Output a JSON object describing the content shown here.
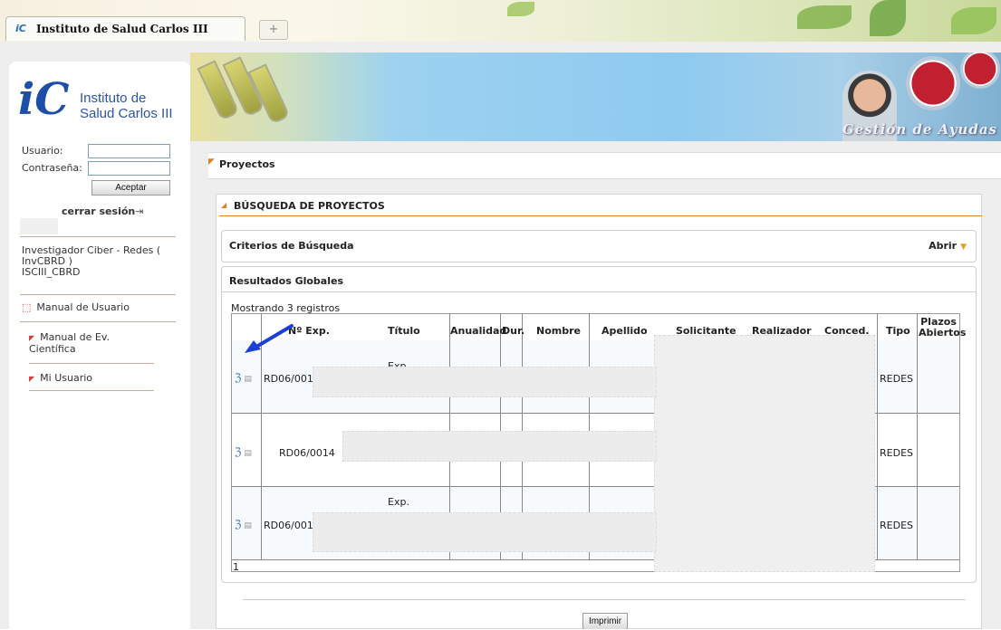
{
  "browser": {
    "tab_title": "Instituto de Salud Carlos III",
    "tab_icon": "isciii-favicon",
    "new_tab_label": "+"
  },
  "logo": {
    "mark": "iC",
    "line1": "Instituto de",
    "line2": "Salud Carlos III"
  },
  "login": {
    "user_label": "Usuario:",
    "user_value": "",
    "password_label": "Contraseña:",
    "password_value": "",
    "accept_label": "Aceptar",
    "logout_label": "cerrar sesión"
  },
  "user_info": {
    "line1": "Investigador Ciber - Redes (",
    "line2": "InvCBRD )",
    "line3": "ISCIII_CBRD"
  },
  "sidebar": {
    "items": [
      {
        "label": "Manual de Usuario"
      },
      {
        "label": "Manual de Ev. Científica"
      },
      {
        "label": "Mi Usuario"
      }
    ]
  },
  "banner": {
    "title": "Gestión de Ayudas"
  },
  "breadcrumb": {
    "label": "Proyectos"
  },
  "main": {
    "title": "BÚSQUEDA DE PROYECTOS",
    "criteria_label": "Criterios de Búsqueda",
    "open_label": "Abrir",
    "results_label": "Resultados Globales",
    "showing": "Mostrando 3 registros",
    "columns": [
      "Nº Exp.",
      "Título",
      "Anualidad",
      "Dur.",
      "Nombre",
      "Apellido",
      "Solicitante",
      "Realizador",
      "Conced.",
      "Tipo",
      "Plazos Abiertos"
    ],
    "rows": [
      {
        "exp": "RD06/001",
        "title": "Exp.",
        "tipo": "REDES"
      },
      {
        "exp": "RD06/0014",
        "title": "",
        "tipo": "REDES"
      },
      {
        "exp": "RD06/001",
        "title": "Exp.",
        "tipo": "REDES"
      }
    ],
    "page": "1",
    "print_label": "Imprimir"
  },
  "colors": {
    "accent": "#d9822b",
    "link": "#2b56a8",
    "annotation_arrow": "#1a3fd6"
  }
}
